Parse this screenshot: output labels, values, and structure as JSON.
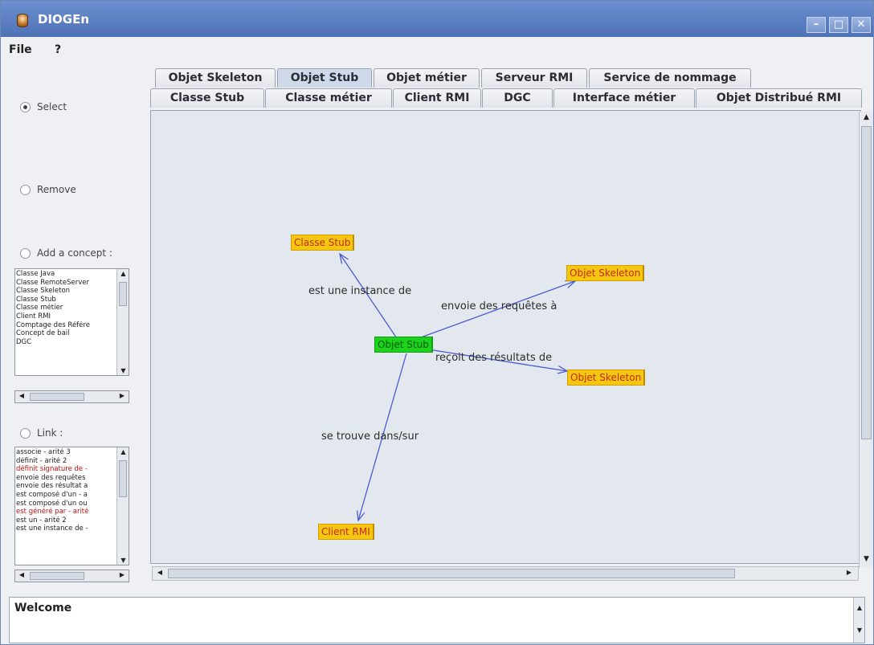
{
  "window": {
    "title": "DIOGEn"
  },
  "menu": {
    "file": "File",
    "help": "?"
  },
  "left_panel": {
    "select_label": "Select",
    "remove_label": "Remove",
    "add_concept_label": "Add a concept :",
    "link_label": "Link :",
    "selected_mode": "Select",
    "concepts": [
      "Classe Java",
      "Classe RemoteServer",
      "Classe Skeleton",
      "Classe Stub",
      "Classe métier",
      "Client RMI",
      "Comptage des Référe",
      "Concept de bail",
      "DGC"
    ],
    "links": [
      {
        "text": "associe - arité 3",
        "color": "black"
      },
      {
        "text": "définit - arité 2",
        "color": "black"
      },
      {
        "text": "définit signature de -",
        "color": "red"
      },
      {
        "text": "envoie des requêtes",
        "color": "black"
      },
      {
        "text": "envoie des résultat a",
        "color": "black"
      },
      {
        "text": "est composé d'un - a",
        "color": "black"
      },
      {
        "text": "est composé d'un ou",
        "color": "black"
      },
      {
        "text": "est généré par - arité",
        "color": "red"
      },
      {
        "text": "est un - arité 2",
        "color": "black"
      },
      {
        "text": "est une instance de -",
        "color": "black"
      }
    ]
  },
  "tabs": {
    "row1": [
      "Objet Skeleton",
      "Objet Stub",
      "Objet métier",
      "Serveur RMI",
      "Service de nommage"
    ],
    "row2": [
      "Classe Stub",
      "Classe métier",
      "Client RMI",
      "DGC",
      "Interface métier",
      "Objet Distribué RMI"
    ],
    "active": "Objet Stub"
  },
  "graph": {
    "nodes": {
      "center": "Objet Stub",
      "classe_stub": "Classe Stub",
      "skeleton1": "Objet Skeleton",
      "skeleton2": "Objet Skeleton",
      "client": "Client RMI"
    },
    "edges": {
      "instance": "est une instance de",
      "requetes": "envoie des requêtes à",
      "resultats": "reçoit des résultats de",
      "trouve": "se trouve dans/sur"
    }
  },
  "status": {
    "message": "Welcome"
  },
  "colors": {
    "node_fill": "#f5c710",
    "selected_node_fill": "#1bd31b",
    "edge": "#4a5bd4",
    "canvas_bg": "#e3e8ee"
  }
}
